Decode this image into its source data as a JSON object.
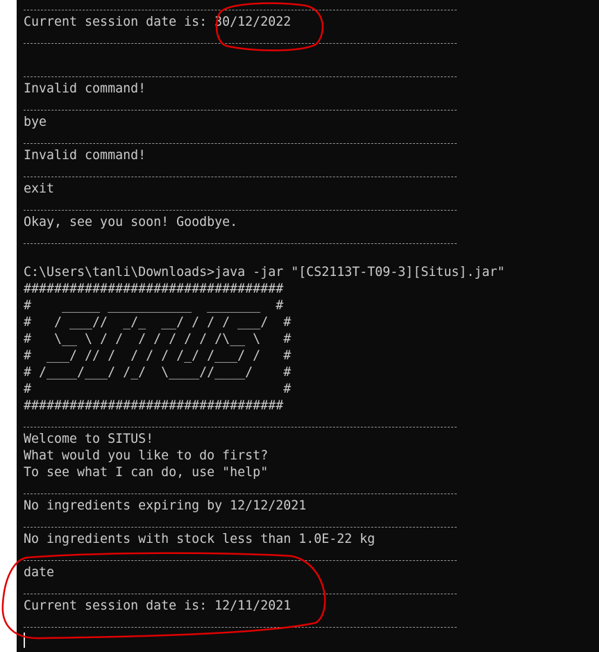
{
  "terminal": {
    "lines": [
      "Current session date is: 30/12/2022",
      "Invalid command!",
      "bye",
      "Invalid command!",
      "exit",
      "Okay, see you soon! Goodbye.",
      "C:\\Users\\tanli\\Downloads>java -jar \"[CS2113T-T09-3][Situs].jar\"",
      "##################################",
      "#    _____ ___________  _______  #",
      "#   / ___//  _/_  __/ / / / ___/  #",
      "#   \\__ \\ / /  / / / / / /\\__ \\   #",
      "#  ___/ // /  / / / /_/ /___/ /   #",
      "# /____/___/ /_/  \\____//____/    #",
      "#                                 #",
      "##################################",
      "Welcome to SITUS!",
      "What would you like to do first?",
      "To see what I can do, use \"help\"",
      "No ingredients expiring by 12/12/2021",
      "No ingredients with stock less than 1.0E-22 kg",
      "date",
      "Current session date is: 12/11/2021"
    ]
  },
  "colors": {
    "background": "#0c0c0c",
    "text": "#cccccc",
    "annotation": "#e00000"
  }
}
